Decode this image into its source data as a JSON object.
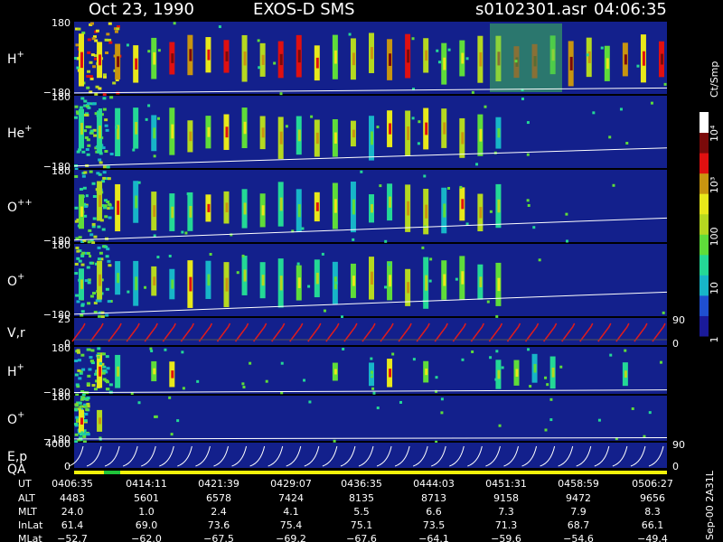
{
  "header": {
    "date": "Oct 23, 1990",
    "instrument": "EXOS-D SMS",
    "file": "s0102301.asr",
    "time": "04:06:35"
  },
  "colors": {
    "background": "#000000",
    "panel_bg": "#13208c",
    "trace_white": "#ffffff",
    "velocity_red": "#e11b1b",
    "qa_bar": "#f2f20a",
    "qa_good": "#1fc43a"
  },
  "colorbar": {
    "unit": "Ct/Smp",
    "tick_labels": [
      "10⁴",
      "10³",
      "100",
      "10",
      "1"
    ],
    "tick_values": [
      10000,
      1000,
      100,
      10,
      1
    ],
    "scale": "log",
    "stops": [
      "#1a1a9a",
      "#1f4fd0",
      "#17b5c8",
      "#24d896",
      "#5fdc3a",
      "#b5d820",
      "#e8e81a",
      "#c89510",
      "#e01010",
      "#7a0a0a",
      "#ffffff"
    ]
  },
  "panels": [
    {
      "species": "H",
      "charge": "+",
      "ymax": "180",
      "ymin": "−180",
      "baseline_start": -175,
      "baseline_end": -150,
      "activity": "strong"
    },
    {
      "species": "He",
      "charge": "+",
      "ymax": "180",
      "ymin": "−180",
      "baseline_start": -170,
      "baseline_end": -80,
      "activity": "medium"
    },
    {
      "species": "O",
      "charge": "++",
      "ymax": "180",
      "ymin": "−180",
      "baseline_start": -170,
      "baseline_end": -60,
      "activity": "medium"
    },
    {
      "species": "O",
      "charge": "+",
      "ymax": "180",
      "ymin": "−180",
      "baseline_start": -170,
      "baseline_end": -60,
      "activity": "medium"
    },
    {
      "species": "V,r",
      "charge": "",
      "ymax": "25",
      "ymin": "0",
      "right_label": "90",
      "right_label_low": "0",
      "kind": "velocity"
    },
    {
      "species": "H",
      "charge": "+",
      "ymax": "180",
      "ymin": "−180",
      "baseline_start": -170,
      "baseline_end": -150,
      "activity": "sparse"
    },
    {
      "species": "O",
      "charge": "+",
      "ymax": "180",
      "ymin": "−180",
      "baseline_start": -165,
      "baseline_end": -155,
      "activity": "faint"
    },
    {
      "species": "E,p",
      "charge": "",
      "ymax": "4000",
      "ymin": "0",
      "right_label": "90",
      "right_label_low": "0",
      "kind": "energy"
    }
  ],
  "qa": {
    "label": "QA"
  },
  "side_label": "Sep-00  2A31L",
  "footer": {
    "row_labels": [
      "UT",
      "ALT",
      "MLT",
      "InLat",
      "MLat"
    ],
    "columns": [
      [
        "0406:35",
        "4483",
        "24.0",
        "61.4",
        "−52.7"
      ],
      [
        "0414:11",
        "5601",
        "1.0",
        "69.0",
        "−62.0"
      ],
      [
        "0421:39",
        "6578",
        "2.4",
        "73.6",
        "−67.5"
      ],
      [
        "0429:07",
        "7424",
        "4.1",
        "75.4",
        "−69.2"
      ],
      [
        "0436:35",
        "8135",
        "5.5",
        "75.1",
        "−67.6"
      ],
      [
        "0444:03",
        "8713",
        "6.6",
        "73.5",
        "−64.1"
      ],
      [
        "0451:31",
        "9158",
        "7.3",
        "71.3",
        "−59.6"
      ],
      [
        "0458:59",
        "9472",
        "7.9",
        "68.7",
        "−54.6"
      ],
      [
        "0506:27",
        "9656",
        "8.3",
        "66.1",
        "−49.4"
      ]
    ]
  },
  "chart_data": {
    "type": "heatmap",
    "title": "Oct 23, 1990   EXOS-D SMS",
    "xlabel": "UT",
    "x": [
      "0406:35",
      "0414:11",
      "0421:39",
      "0429:07",
      "0436:35",
      "0444:03",
      "0451:31",
      "0458:59",
      "0506:27"
    ],
    "series": [
      {
        "name": "H+",
        "yrange": [
          -180,
          180
        ]
      },
      {
        "name": "He+",
        "yrange": [
          -180,
          180
        ]
      },
      {
        "name": "O++",
        "yrange": [
          -180,
          180
        ]
      },
      {
        "name": "O+",
        "yrange": [
          -180,
          180
        ]
      },
      {
        "name": "V,r",
        "yrange": [
          0,
          25
        ]
      },
      {
        "name": "H+",
        "yrange": [
          -180,
          180
        ]
      },
      {
        "name": "O+",
        "yrange": [
          -180,
          180
        ]
      },
      {
        "name": "E,p",
        "yrange": [
          0,
          4000
        ]
      }
    ],
    "colorbar_unit": "Ct/Smp",
    "colorbar_range": [
      1,
      10000
    ]
  }
}
